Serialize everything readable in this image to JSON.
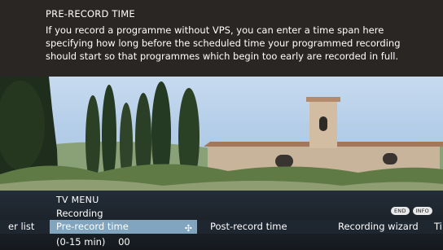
{
  "help": {
    "title": "PRE-RECORD TIME",
    "text": "If you record a programme without VPS, you can enter a time span here specifying how long before the scheduled time your programmed recording should start so that programmes which begin too early are recorded in full."
  },
  "menu": {
    "title": "TV MENU",
    "subtitle": "Recording",
    "keys": {
      "end": "END",
      "info": "INFO"
    },
    "tabs": {
      "left_partial": "er list",
      "active": "Pre-record time",
      "post": "Post-record time",
      "wizard": "Recording wizard",
      "right_partial": "Ti"
    },
    "range_hint": "(0-15 min)",
    "value": "00"
  }
}
